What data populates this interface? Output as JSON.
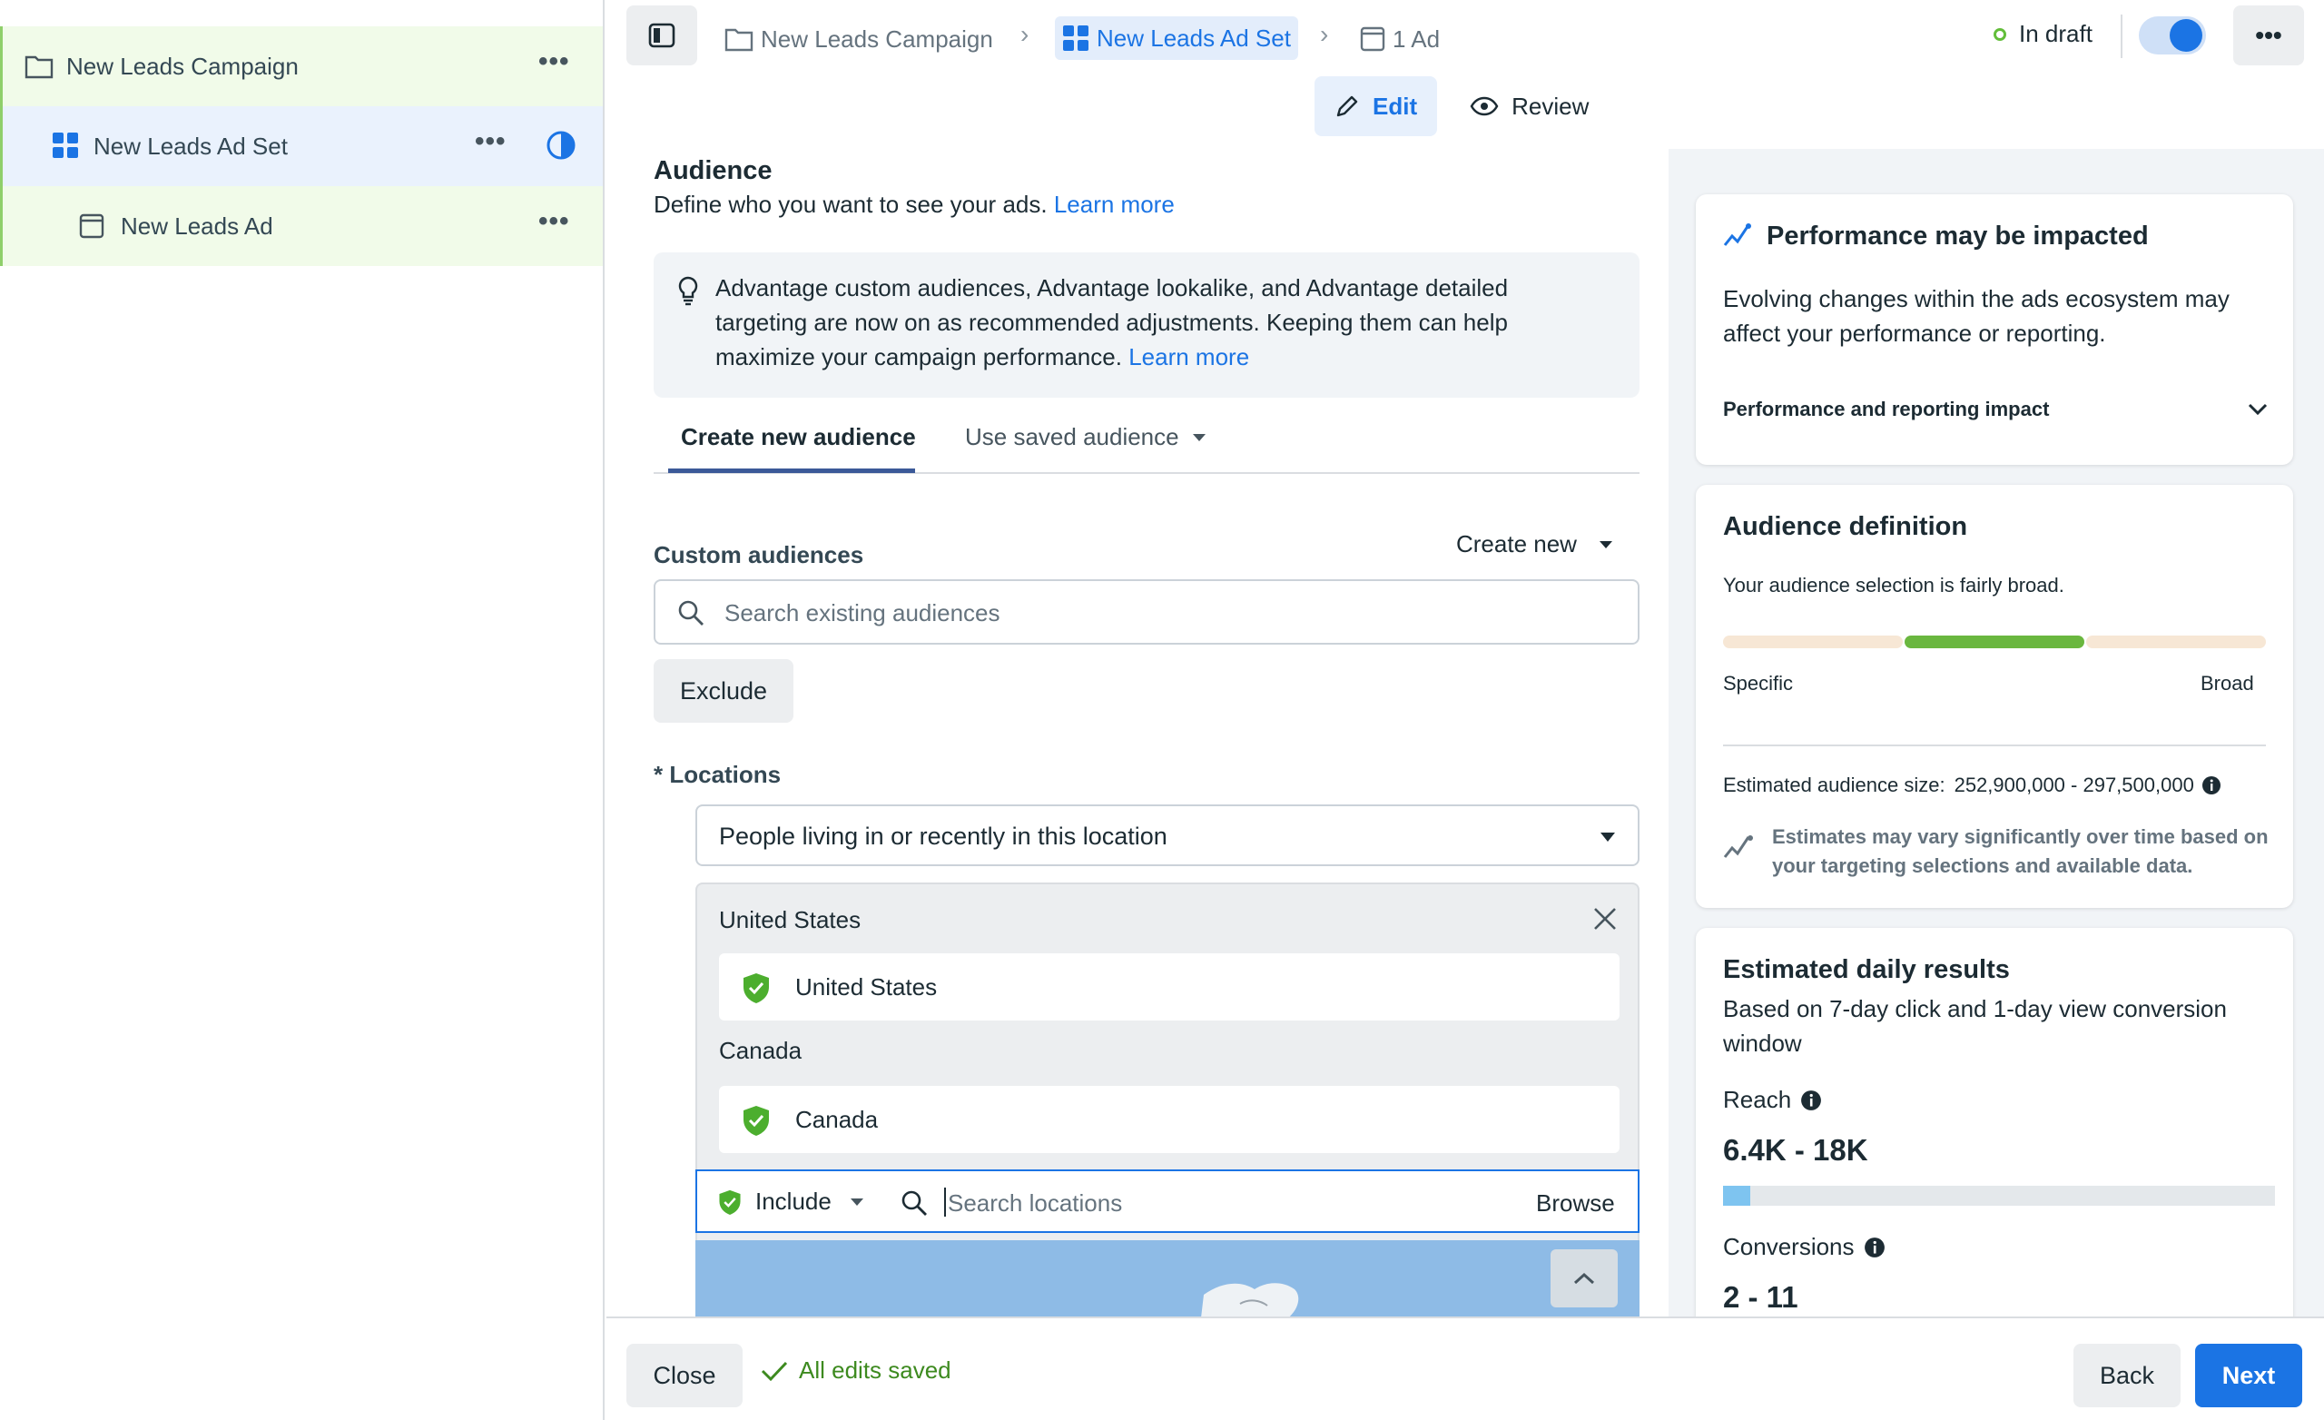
{
  "tree": {
    "campaign": "New Leads Campaign",
    "adset": "New Leads Ad Set",
    "ad": "New Leads Ad"
  },
  "breadcrumb": {
    "campaign": "New Leads Campaign",
    "adset": "New Leads Ad Set",
    "ad": "1 Ad"
  },
  "status": {
    "label": "In draft",
    "toggle_on": true
  },
  "modes": {
    "edit": "Edit",
    "review": "Review"
  },
  "audience": {
    "title": "Audience",
    "description": "Define who you want to see your ads.",
    "learn_more": "Learn more",
    "notice": "Advantage custom audiences, Advantage lookalike, and Advantage detailed targeting are now on as recommended adjustments. Keeping them can help maximize your campaign performance.",
    "notice_learn_more": "Learn more",
    "tabs": {
      "create": "Create new audience",
      "saved": "Use saved audience"
    },
    "custom_audiences": {
      "label": "Custom audiences",
      "create_new": "Create new",
      "search_placeholder": "Search existing audiences",
      "exclude": "Exclude"
    },
    "locations": {
      "label": "* Locations",
      "type_select": "People living in or recently in this location",
      "groups": [
        {
          "header": "United States",
          "item": "United States"
        },
        {
          "header": "Canada",
          "item": "Canada"
        }
      ],
      "include": "Include",
      "search_placeholder": "Search locations",
      "browse": "Browse"
    }
  },
  "performance_card": {
    "title": "Performance may be impacted",
    "body": "Evolving changes within the ads ecosystem may affect your performance or reporting.",
    "expander": "Performance and reporting impact"
  },
  "definition_card": {
    "title": "Audience definition",
    "summary": "Your audience selection is fairly broad.",
    "left_label": "Specific",
    "right_label": "Broad",
    "size_label": "Estimated audience size:",
    "size_value": "252,900,000 - 297,500,000",
    "disclaimer": "Estimates may vary significantly over time based on your targeting selections and available data.",
    "colors": {
      "light": "#f7e7d5",
      "active": "#6ab73f"
    }
  },
  "daily_card": {
    "title": "Estimated daily results",
    "subtitle": "Based on 7-day click and 1-day view conversion window",
    "reach_label": "Reach",
    "reach_value": "6.4K - 18K",
    "reach_fill": 0.05,
    "conversions_label": "Conversions",
    "conversions_value": "2 - 11"
  },
  "footer": {
    "close": "Close",
    "saved": "All edits saved",
    "back": "Back",
    "next": "Next"
  }
}
